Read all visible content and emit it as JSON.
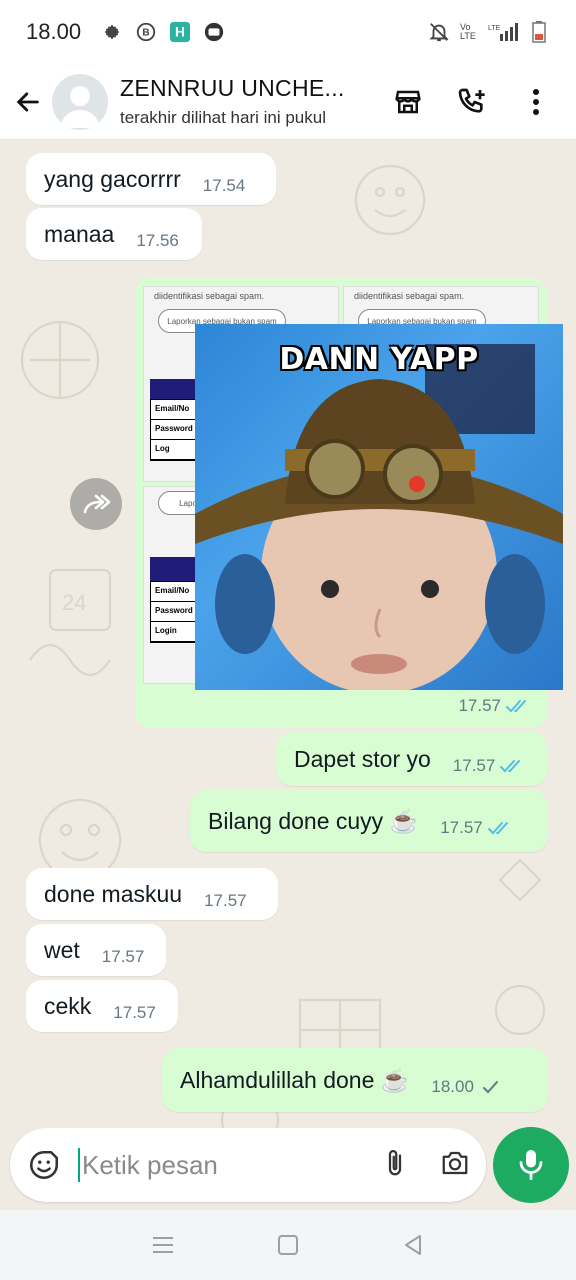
{
  "status_bar": {
    "time": "18.00",
    "icons": [
      "settings-icon",
      "b-badge-icon",
      "h-app-icon",
      "chat-app-icon",
      "mute-icon",
      "volte-icon",
      "signal-icon",
      "battery-icon"
    ],
    "volte": "Vo LTE",
    "lte": "LTE"
  },
  "header": {
    "contact_name": "ZENNRUU UNCHE...",
    "contact_status": "terakhir dilihat hari ini pukul",
    "icons": [
      "back-arrow-icon",
      "avatar",
      "store-icon",
      "add-call-icon",
      "more-vert-icon"
    ]
  },
  "messages": [
    {
      "dir": "in",
      "text": "yang gacorrrr",
      "time": "17.54"
    },
    {
      "dir": "in",
      "text": "manaa",
      "time": "17.56"
    },
    {
      "dir": "out",
      "type": "image",
      "time": "17.57",
      "status": "read"
    },
    {
      "dir": "out",
      "text": "Dapet stor yo",
      "time": "17.57",
      "status": "read"
    },
    {
      "dir": "out",
      "text": "Bilang done cuyy ☕",
      "time": "17.57",
      "status": "read"
    },
    {
      "dir": "in",
      "text": "done maskuu",
      "time": "17.57"
    },
    {
      "dir": "in",
      "text": "wet",
      "time": "17.57"
    },
    {
      "dir": "in",
      "text": "cekk",
      "time": "17.57"
    },
    {
      "dir": "out",
      "text": "Alhamdulillah done ☕",
      "time": "18.00",
      "status": "sent"
    }
  ],
  "image_message": {
    "screenshot_spam_text": "diidentifikasi sebagai spam.",
    "screenshot_button": "Laporkan sebagai bukan spam",
    "form_fields": [
      "Email/No",
      "Password",
      "Log"
    ],
    "form_fields_2": [
      "Email/No",
      "Password",
      "Login"
    ],
    "meme_caption": "DANN YAPP"
  },
  "input": {
    "placeholder": "Ketik pesan"
  },
  "colors": {
    "incoming_bubble": "#ffffff",
    "outgoing_bubble": "#d9fdd3",
    "read_tick": "#53bdeb",
    "mic_button": "#1daa61",
    "background": "#efeae2"
  }
}
